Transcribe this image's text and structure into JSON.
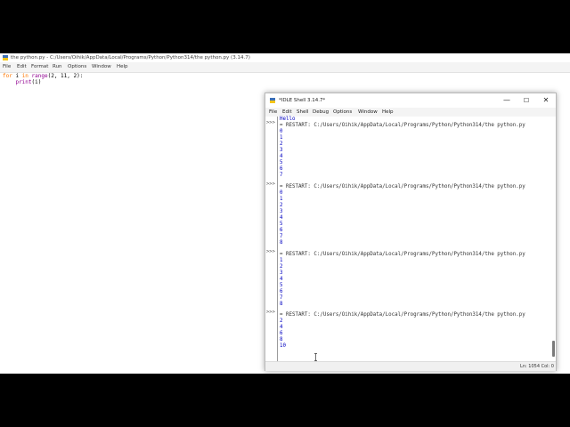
{
  "editor": {
    "title": "the python.py - C:/Users/Oihik/AppData/Local/Programs/Python/Python314/the python.py (3.14.7)",
    "menu": [
      "File",
      "Edit",
      "Format",
      "Run",
      "Options",
      "Window",
      "Help"
    ],
    "code": {
      "line1": {
        "kw": "for",
        "rest1": " i ",
        "kw2": "in",
        "sp": " ",
        "bi": "range",
        "rest2": "(2, 11, 2):"
      },
      "line2": {
        "indent": "    ",
        "bi": "print",
        "rest": "(i)"
      }
    }
  },
  "shell": {
    "title": "*IDLE Shell 3.14.7*",
    "controls": {
      "minimize": "—",
      "maximize": "☐",
      "close": "✕"
    },
    "menu": [
      "File",
      "Edit",
      "Shell",
      "Debug",
      "Options",
      "Window",
      "Help"
    ],
    "prompt": ">>>",
    "hello": "Hello",
    "restart_text": "= RESTART: C:/Users/Oihik/AppData/Local/Programs/Python/Python314/the python.py",
    "runs": [
      [
        "0",
        "1",
        "2",
        "3",
        "4",
        "5",
        "6",
        "7"
      ],
      [
        "0",
        "1",
        "2",
        "3",
        "4",
        "5",
        "6",
        "7",
        "8"
      ],
      [
        "1",
        "2",
        "3",
        "4",
        "5",
        "6",
        "7",
        "8"
      ],
      [
        "2",
        "4",
        "6",
        "8",
        "10"
      ]
    ],
    "status": {
      "line": "Ln: 1054",
      "col": "Col: 0"
    }
  }
}
